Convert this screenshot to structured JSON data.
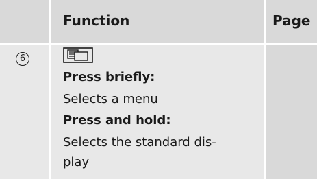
{
  "header": {
    "function_label": "Function",
    "page_label": "Page"
  },
  "row": {
    "index": "6",
    "key_icon": "display-button-icon",
    "press_briefly_label": "Press briefly:",
    "press_briefly_text": "Selects a menu",
    "press_hold_label": "Press and hold:",
    "press_hold_text_line1": "Selects the standard dis-",
    "press_hold_text_line2": "play",
    "page": ""
  },
  "colors": {
    "header_bg": "#d9d9d9",
    "body_bg": "#e8e8e8",
    "page_col_bg": "#d9d9d9",
    "divider": "#ffffff"
  }
}
